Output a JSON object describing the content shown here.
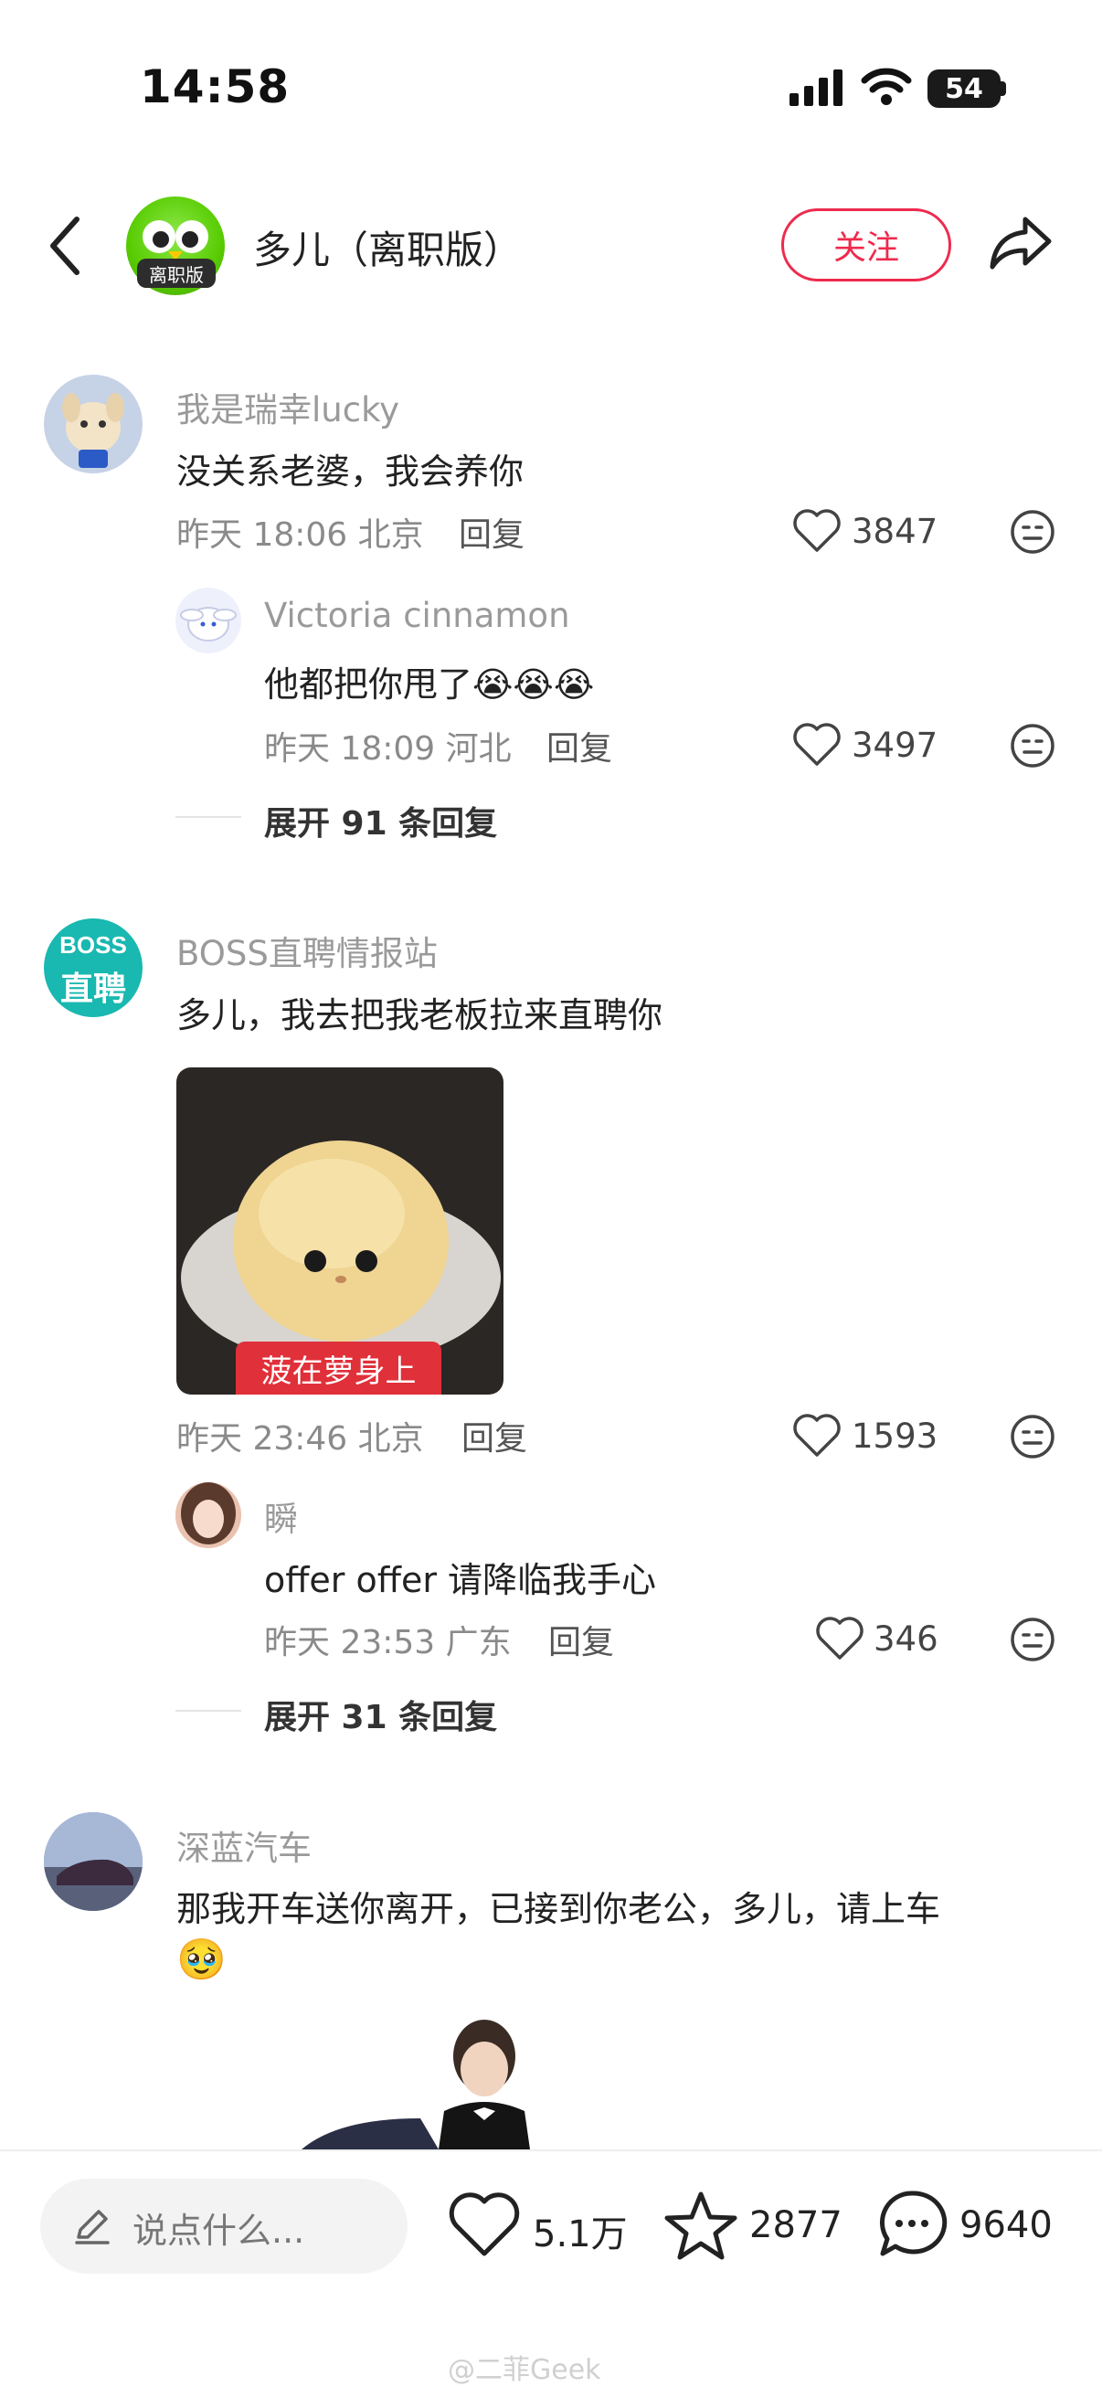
{
  "status_bar": {
    "time": "14:58",
    "battery": "54"
  },
  "header": {
    "title": "多儿（离职版）",
    "avatar_tag": "离职版",
    "follow_label": "关注"
  },
  "comments": [
    {
      "user": "我是瑞幸lucky",
      "text": "没关系老婆，我会养你",
      "time": "昨天 18:06",
      "location": "北京",
      "reply": "回复",
      "likes": "3847",
      "reply_sub": {
        "user": "Victoria cinnamon",
        "text": "他都把你甩了",
        "emojis": "😭😭😭",
        "time": "昨天 18:09",
        "location": "河北",
        "reply": "回复",
        "likes": "3497"
      },
      "expand": "展开 91 条回复"
    },
    {
      "user": "BOSS直聘情报站",
      "avatar_text": [
        "BOSS",
        "直聘"
      ],
      "text": "多儿，我去把我老板拉来直聘你",
      "image_caption": "菠在萝身上",
      "time": "昨天 23:46",
      "location": "北京",
      "reply": "回复",
      "likes": "1593",
      "reply_sub": {
        "user": "瞬",
        "text": "offer offer 请降临我手心",
        "time": "昨天 23:53",
        "location": "广东",
        "reply": "回复",
        "likes": "346"
      },
      "expand": "展开 31 条回复"
    },
    {
      "user": "深蓝汽车",
      "text": "那我开车送你离开，已接到你老公，多儿，请上车",
      "emoji": "🥹"
    }
  ],
  "bottom_bar": {
    "input_placeholder": "说点什么...",
    "likes": "5.1万",
    "favorites": "2877",
    "comments": "9640"
  },
  "watermark": "@二菲Geek",
  "colors": {
    "accent": "#ee2a4d",
    "boss_teal": "#19b8b0",
    "duo_green": "#58cc02"
  }
}
